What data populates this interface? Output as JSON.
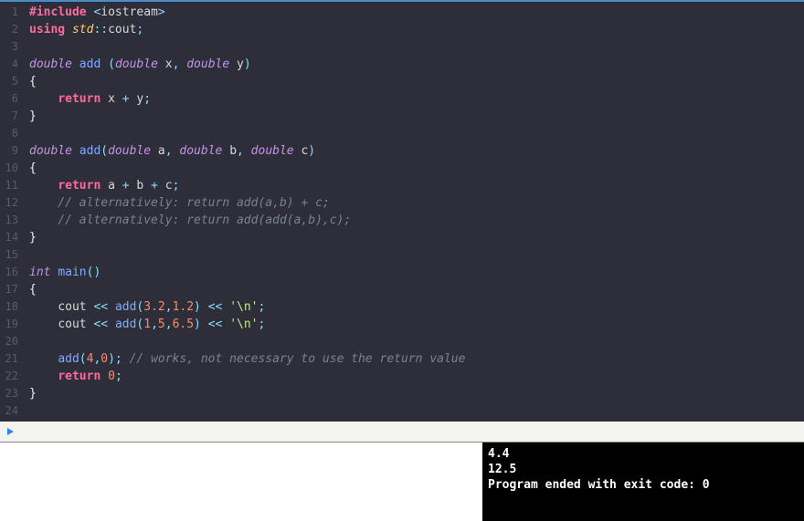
{
  "lines": [
    {
      "n": "1",
      "tokens": [
        {
          "c": "kw",
          "t": "#include "
        },
        {
          "c": "op",
          "t": "<"
        },
        {
          "c": "id",
          "t": "iostream"
        },
        {
          "c": "op",
          "t": ">"
        }
      ]
    },
    {
      "n": "2",
      "tokens": [
        {
          "c": "kw",
          "t": "using "
        },
        {
          "c": "type",
          "t": "std"
        },
        {
          "c": "op",
          "t": "::"
        },
        {
          "c": "id",
          "t": "cout"
        },
        {
          "c": "op",
          "t": ";"
        }
      ]
    },
    {
      "n": "3",
      "tokens": []
    },
    {
      "n": "4",
      "tokens": [
        {
          "c": "kw2",
          "t": "double "
        },
        {
          "c": "fn",
          "t": "add "
        },
        {
          "c": "op",
          "t": "("
        },
        {
          "c": "kw2",
          "t": "double "
        },
        {
          "c": "id",
          "t": "x"
        },
        {
          "c": "op",
          "t": ", "
        },
        {
          "c": "kw2",
          "t": "double "
        },
        {
          "c": "id",
          "t": "y"
        },
        {
          "c": "op",
          "t": ")"
        }
      ]
    },
    {
      "n": "5",
      "tokens": [
        {
          "c": "wh",
          "t": "{"
        }
      ]
    },
    {
      "n": "6",
      "tokens": [
        {
          "c": "",
          "t": "    "
        },
        {
          "c": "kw",
          "t": "return "
        },
        {
          "c": "id",
          "t": "x "
        },
        {
          "c": "op",
          "t": "+ "
        },
        {
          "c": "id",
          "t": "y"
        },
        {
          "c": "op",
          "t": ";"
        }
      ]
    },
    {
      "n": "7",
      "tokens": [
        {
          "c": "wh",
          "t": "}"
        }
      ]
    },
    {
      "n": "8",
      "tokens": []
    },
    {
      "n": "9",
      "tokens": [
        {
          "c": "kw2",
          "t": "double "
        },
        {
          "c": "fn",
          "t": "add"
        },
        {
          "c": "op",
          "t": "("
        },
        {
          "c": "kw2",
          "t": "double "
        },
        {
          "c": "id",
          "t": "a"
        },
        {
          "c": "op",
          "t": ", "
        },
        {
          "c": "kw2",
          "t": "double "
        },
        {
          "c": "id",
          "t": "b"
        },
        {
          "c": "op",
          "t": ", "
        },
        {
          "c": "kw2",
          "t": "double "
        },
        {
          "c": "id",
          "t": "c"
        },
        {
          "c": "op",
          "t": ")"
        }
      ]
    },
    {
      "n": "10",
      "tokens": [
        {
          "c": "wh",
          "t": "{"
        }
      ]
    },
    {
      "n": "11",
      "tokens": [
        {
          "c": "",
          "t": "    "
        },
        {
          "c": "kw",
          "t": "return "
        },
        {
          "c": "id",
          "t": "a "
        },
        {
          "c": "op",
          "t": "+ "
        },
        {
          "c": "id",
          "t": "b "
        },
        {
          "c": "op",
          "t": "+ "
        },
        {
          "c": "id",
          "t": "c"
        },
        {
          "c": "op",
          "t": ";"
        }
      ]
    },
    {
      "n": "12",
      "tokens": [
        {
          "c": "",
          "t": "    "
        },
        {
          "c": "cmt",
          "t": "// alternatively: return add(a,b) + c;"
        }
      ]
    },
    {
      "n": "13",
      "tokens": [
        {
          "c": "",
          "t": "    "
        },
        {
          "c": "cmt",
          "t": "// alternatively: return add(add(a,b),c);"
        }
      ]
    },
    {
      "n": "14",
      "tokens": [
        {
          "c": "wh",
          "t": "}"
        }
      ]
    },
    {
      "n": "15",
      "tokens": []
    },
    {
      "n": "16",
      "tokens": [
        {
          "c": "kw2",
          "t": "int "
        },
        {
          "c": "fn",
          "t": "main"
        },
        {
          "c": "op",
          "t": "()"
        }
      ]
    },
    {
      "n": "17",
      "tokens": [
        {
          "c": "wh",
          "t": "{"
        }
      ]
    },
    {
      "n": "18",
      "tokens": [
        {
          "c": "",
          "t": "    "
        },
        {
          "c": "id",
          "t": "cout "
        },
        {
          "c": "op",
          "t": "<< "
        },
        {
          "c": "fn",
          "t": "add"
        },
        {
          "c": "op",
          "t": "("
        },
        {
          "c": "num",
          "t": "3.2"
        },
        {
          "c": "op",
          "t": ","
        },
        {
          "c": "num",
          "t": "1.2"
        },
        {
          "c": "op",
          "t": ") "
        },
        {
          "c": "op",
          "t": "<< "
        },
        {
          "c": "str",
          "t": "'\\n'"
        },
        {
          "c": "op",
          "t": ";"
        }
      ]
    },
    {
      "n": "19",
      "tokens": [
        {
          "c": "",
          "t": "    "
        },
        {
          "c": "id",
          "t": "cout "
        },
        {
          "c": "op",
          "t": "<< "
        },
        {
          "c": "fn",
          "t": "add"
        },
        {
          "c": "op",
          "t": "("
        },
        {
          "c": "num",
          "t": "1"
        },
        {
          "c": "op",
          "t": ","
        },
        {
          "c": "num",
          "t": "5"
        },
        {
          "c": "op",
          "t": ","
        },
        {
          "c": "num",
          "t": "6.5"
        },
        {
          "c": "op",
          "t": ") "
        },
        {
          "c": "op",
          "t": "<< "
        },
        {
          "c": "str",
          "t": "'\\n'"
        },
        {
          "c": "op",
          "t": ";"
        }
      ]
    },
    {
      "n": "20",
      "tokens": []
    },
    {
      "n": "21",
      "tokens": [
        {
          "c": "",
          "t": "    "
        },
        {
          "c": "fn",
          "t": "add"
        },
        {
          "c": "op",
          "t": "("
        },
        {
          "c": "num",
          "t": "4"
        },
        {
          "c": "op",
          "t": ","
        },
        {
          "c": "num",
          "t": "0"
        },
        {
          "c": "op",
          "t": "); "
        },
        {
          "c": "cmt",
          "t": "// works, not necessary to use the return value"
        }
      ]
    },
    {
      "n": "22",
      "tokens": [
        {
          "c": "",
          "t": "    "
        },
        {
          "c": "kw",
          "t": "return "
        },
        {
          "c": "num",
          "t": "0"
        },
        {
          "c": "op",
          "t": ";"
        }
      ]
    },
    {
      "n": "23",
      "tokens": [
        {
          "c": "wh",
          "t": "}"
        }
      ]
    },
    {
      "n": "24",
      "tokens": []
    }
  ],
  "console": {
    "out1": "4.4",
    "out2": "12.5",
    "out3": "Program ended with exit code: 0"
  }
}
